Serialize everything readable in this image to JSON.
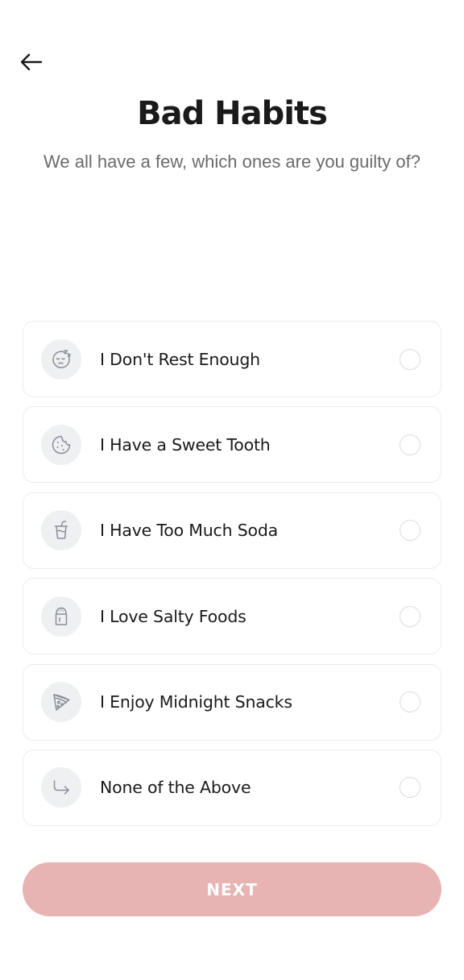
{
  "header": {
    "back_icon": "arrow-left-icon",
    "title": "Bad Habits",
    "subtitle": "We all have a few, which ones are you guilty of?"
  },
  "options": [
    {
      "label": "I Don't Rest Enough",
      "icon": "sleeping-face-icon",
      "selected": false
    },
    {
      "label": "I Have a Sweet Tooth",
      "icon": "cookie-icon",
      "selected": false
    },
    {
      "label": "I Have Too Much Soda",
      "icon": "soda-cup-icon",
      "selected": false
    },
    {
      "label": "I Love Salty Foods",
      "icon": "salt-shaker-icon",
      "selected": false
    },
    {
      "label": "I Enjoy Midnight Snacks",
      "icon": "pizza-slice-icon",
      "selected": false
    },
    {
      "label": "None of the Above",
      "icon": "arrow-turn-right-icon",
      "selected": false
    }
  ],
  "footer": {
    "next_label": "NEXT"
  },
  "colors": {
    "icon_stroke": "#8a8f98",
    "next_button_bg": "#e8b4b3",
    "icon_circle_bg": "#eef0f2"
  }
}
